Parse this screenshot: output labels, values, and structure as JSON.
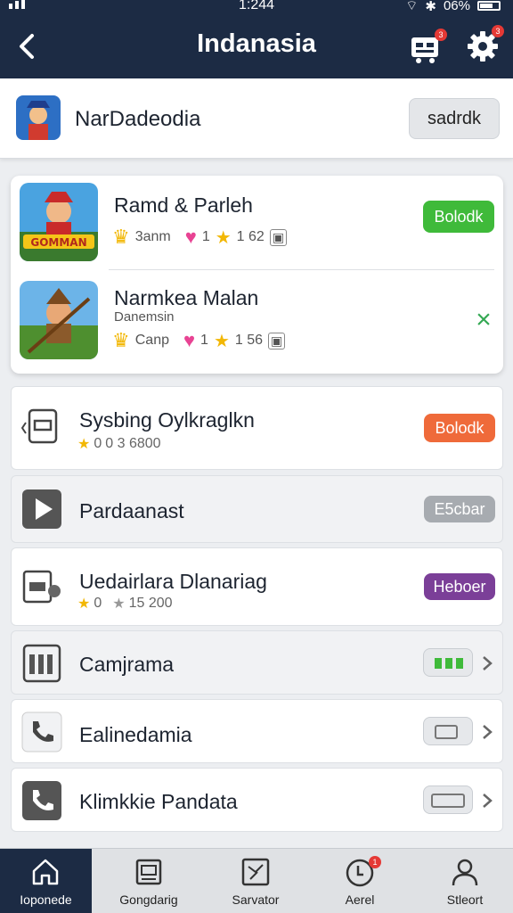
{
  "status_bar": {
    "time": "1:244",
    "battery": "06%"
  },
  "header": {
    "title": "Indanasia",
    "cart_badge": "3",
    "settings_badge": "3"
  },
  "account": {
    "name": "NarDadeodia",
    "button_label": "sadrdk"
  },
  "games": [
    {
      "title": "Ramd & Parleh",
      "subtitle": "",
      "tag": "3anm",
      "rating": "1",
      "count": "1 62",
      "action": "Bolodk",
      "action_color": "#3fba3a",
      "thumb_text": "GOMMAN"
    },
    {
      "title": "Narmkea Malan",
      "subtitle": "Danemsin",
      "tag": "Canp",
      "rating": "1",
      "count": "1 56",
      "action": "×",
      "action_color": "#34a853",
      "thumb_text": ""
    }
  ],
  "list": [
    {
      "title": "Sysbing Oylkraglkn",
      "meta_rating": "0",
      "meta_count": "0 3 6800",
      "button": "Bolodk",
      "button_color": "#ef6a3a"
    },
    {
      "title": "Pardaanast",
      "button": "E5cbar",
      "button_color": "#a7abb0"
    },
    {
      "title": "Uedairlara Dlanariag",
      "meta_rating": "0",
      "meta_count": "15 200",
      "button": "Heboer",
      "button_color": "#7b3f98"
    },
    {
      "title": "Camjrama"
    },
    {
      "title": "Ealinedamia"
    },
    {
      "title": "Klimkkie Pandata"
    }
  ],
  "nav": [
    {
      "label": "Ioponede",
      "icon": "home-icon"
    },
    {
      "label": "Gongdarig",
      "icon": "gallery-icon"
    },
    {
      "label": "Sarvator",
      "icon": "compass-icon"
    },
    {
      "label": "Aerel",
      "icon": "clock-icon",
      "badge": "1"
    },
    {
      "label": "Stleort",
      "icon": "profile-icon"
    }
  ],
  "colors": {
    "header": "#1c2b44",
    "green": "#3fba3a",
    "orange": "#ef6a3a",
    "purple": "#7b3f98",
    "gray_pill": "#a7abb0"
  }
}
